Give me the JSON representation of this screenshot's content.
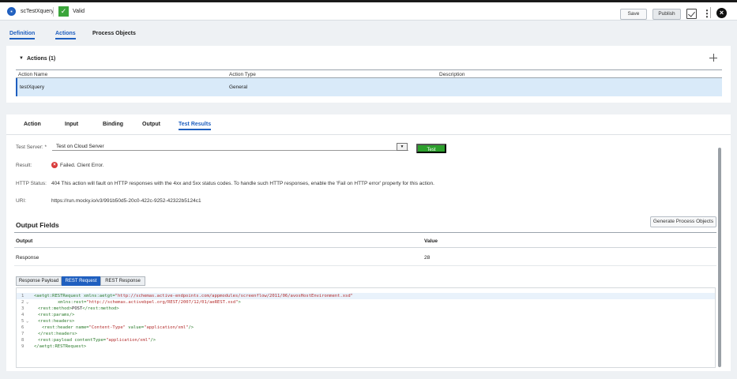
{
  "header": {
    "app_name": "scTestXquery",
    "valid_label": "Valid",
    "save_label": "Save",
    "publish_label": "Publish",
    "check_mark": "✓",
    "close_mark": "×",
    "kebab_mark": "⋮"
  },
  "top_tabs": [
    {
      "label": "Definition",
      "active": true
    },
    {
      "label": "Actions",
      "active": true
    },
    {
      "label": "Process Objects",
      "active": false
    }
  ],
  "actions": {
    "title": "Actions (1)",
    "caret": "▼",
    "columns": [
      "Action Name",
      "Action Type",
      "Description"
    ],
    "rows": [
      {
        "name": "testXquery",
        "type": "General",
        "description": ""
      }
    ]
  },
  "sub_tabs": [
    {
      "label": "Action",
      "active": false
    },
    {
      "label": "Input",
      "active": false
    },
    {
      "label": "Binding",
      "active": false
    },
    {
      "label": "Output",
      "active": false
    },
    {
      "label": "Test Results",
      "active": true
    }
  ],
  "test": {
    "server_label": "Test Server: *",
    "server_value": "Test on Cloud Server",
    "select_arrow": "▼",
    "test_button": "Test",
    "result_label": "Result:",
    "result_value": "Failed. Client Error.",
    "fail_mark": "×",
    "http_status_label": "HTTP Status:",
    "http_status_value": "404 This action will fault on HTTP responses with the 4xx and 5xx status codes. To handle such HTTP responses, enable the 'Fail on HTTP error' property for this action.",
    "uri_label": "URI:",
    "uri_value": "https://run.mocky.io/v3/991b50d5-20c0-422c-9252-42322b5124c1"
  },
  "output_fields": {
    "title": "Output Fields",
    "generate_button": "Generate Process Objects",
    "columns": [
      "Output",
      "Value"
    ],
    "rows": [
      {
        "output": "Response",
        "value": "28"
      }
    ]
  },
  "payload_tabs": [
    {
      "label": "Response Payload",
      "active": false
    },
    {
      "label": "REST Request",
      "active": true
    },
    {
      "label": "REST Response",
      "active": false
    }
  ],
  "code_lines": [
    {
      "n": "1",
      "marker": "",
      "text": "<aetgt:RESTRequest xmlns:aetgt=\"http://schemas.active-endpoints.com/appmodules/screenflow/2011/06/avosHostEnvironment.xsd\"",
      "indent": 0
    },
    {
      "n": "2",
      "marker": "⌄",
      "text": "xmlns:rest=\"http://schemas.activebpel.org/REST/2007/12/01/aeREST.xsd\">",
      "indent": 6
    },
    {
      "n": "3",
      "marker": "",
      "text": "<rest:method>POST</rest:method>",
      "indent": 1
    },
    {
      "n": "4",
      "marker": "",
      "text": "<rest:params/>",
      "indent": 1
    },
    {
      "n": "5",
      "marker": "⌄",
      "text": "<rest:headers>",
      "indent": 1
    },
    {
      "n": "6",
      "marker": "",
      "text": "<rest:header name=\"Content-Type\" value=\"application/xml\"/>",
      "indent": 2
    },
    {
      "n": "7",
      "marker": "",
      "text": "</rest:headers>",
      "indent": 1
    },
    {
      "n": "8",
      "marker": "",
      "text": "<rest:payload contentType=\"application/xml\"/>",
      "indent": 1
    },
    {
      "n": "9",
      "marker": "",
      "text": "</aetgt:RESTRequest>",
      "indent": 0
    }
  ]
}
